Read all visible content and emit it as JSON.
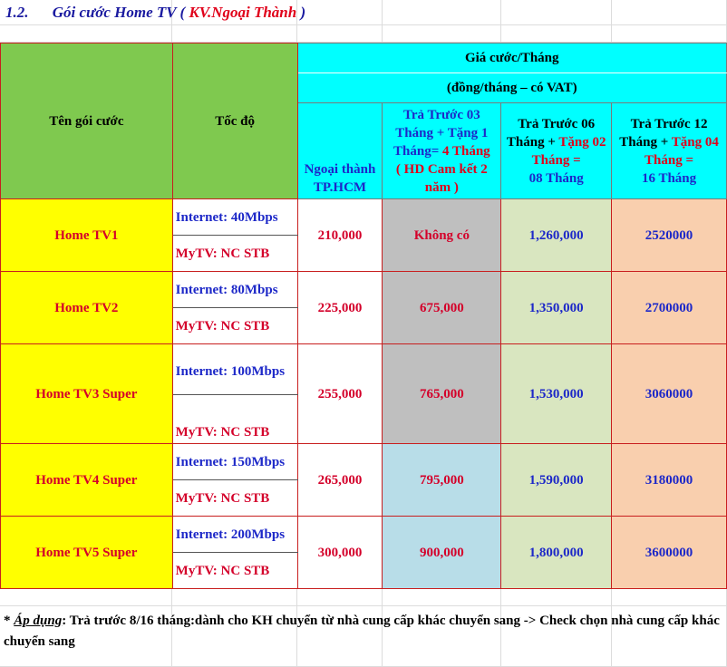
{
  "heading": {
    "number": "1.2.",
    "prefix": "Gói cước Home TV (",
    "region": "KV.Ngoại Thành",
    "suffix": ")"
  },
  "table": {
    "col_name": "Tên gói cước",
    "col_speed": "Tốc độ",
    "price_group": "Giá cước/Tháng",
    "price_unit": "(đồng/tháng – có VAT)",
    "col_region": [
      "Ngoại thành",
      "TP.HCM"
    ],
    "col_prepay3": {
      "a": "Trả Trước 03 Tháng + Tặng 1 Tháng=",
      "b": "4 Tháng",
      "c": "( HD Cam kết 2 năm )"
    },
    "col_prepay6": {
      "a": "Trả Trước 06 Tháng +",
      "b": "Tặng 02 Tháng =",
      "c": "08 Tháng"
    },
    "col_prepay12": {
      "a": "Trả Trước 12 Tháng +",
      "b": "Tặng 04 Tháng =",
      "c": "16 Tháng"
    },
    "rows": [
      {
        "name": "Home TV1",
        "internet": "Internet: 40Mbps",
        "mytv": "MyTV: NC STB",
        "price": "210,000",
        "p3": "Không có",
        "p6": "1,260,000",
        "p12": "2520000"
      },
      {
        "name": "Home TV2",
        "internet": "Internet: 80Mbps",
        "mytv": "MyTV: NC STB",
        "price": "225,000",
        "p3": "675,000",
        "p6": "1,350,000",
        "p12": "2700000"
      },
      {
        "name": "Home TV3 Super",
        "internet": "Internet: 100Mbps",
        "mytv": "MyTV: NC STB",
        "price": "255,000",
        "p3": "765,000",
        "p6": "1,530,000",
        "p12": "3060000"
      },
      {
        "name": "Home TV4 Super",
        "internet": "Internet: 150Mbps",
        "mytv": "MyTV: NC STB",
        "price": "265,000",
        "p3": "795,000",
        "p6": "1,590,000",
        "p12": "3180000"
      },
      {
        "name": "Home TV5 Super",
        "internet": "Internet: 200Mbps",
        "mytv": "MyTV: NC STB",
        "price": "300,000",
        "p3": "900,000",
        "p6": "1,800,000",
        "p12": "3600000"
      }
    ]
  },
  "note": {
    "star": "* ",
    "label": "Áp dụng",
    "text": ": Trả trước 8/16 tháng:dành cho KH chuyển từ nhà cung cấp khác chuyển sang -> Check chọn nhà cung cấp khác chuyển sang"
  }
}
